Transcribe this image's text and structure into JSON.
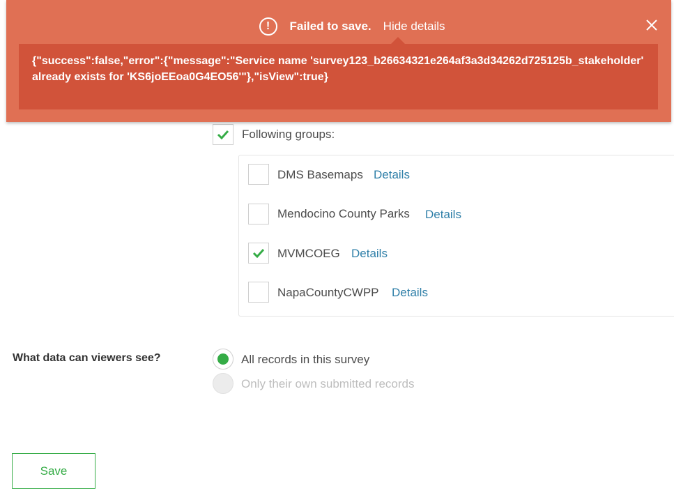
{
  "banner": {
    "title": "Failed to save.",
    "hide_details_label": "Hide details",
    "error_text": "{\"success\":false,\"error\":{\"message\":\"Service name 'survey123_b26634321e264af3a3d34262d725125b_stakeholder' already exists for 'KS6joEEoa0G4EO56'\"},\"isView\":true}",
    "colors": {
      "background": "#e07054",
      "details_background": "#d1533a"
    },
    "icons": {
      "alert": "exclamation-circle-icon",
      "close": "close-icon"
    }
  },
  "sharing": {
    "following_groups_label": "Following groups:",
    "following_groups_checked": true,
    "groups": [
      {
        "name": "DMS Basemaps",
        "details_label": "Details",
        "checked": false
      },
      {
        "name": "Mendocino County Parks",
        "details_label": "Details",
        "checked": false
      },
      {
        "name": "MVMCOEG",
        "details_label": "Details",
        "checked": true
      },
      {
        "name": "NapaCountyCWPP",
        "details_label": "Details",
        "checked": false
      }
    ]
  },
  "viewers": {
    "question": "What data can viewers see?",
    "options": [
      {
        "label": "All records in this survey",
        "selected": true,
        "disabled": false
      },
      {
        "label": "Only their own submitted records",
        "selected": false,
        "disabled": true
      }
    ]
  },
  "save_label": "Save",
  "colors": {
    "accent_green": "#35ac46",
    "link_blue": "#2f7fa8",
    "text": "#4c4c4c"
  }
}
